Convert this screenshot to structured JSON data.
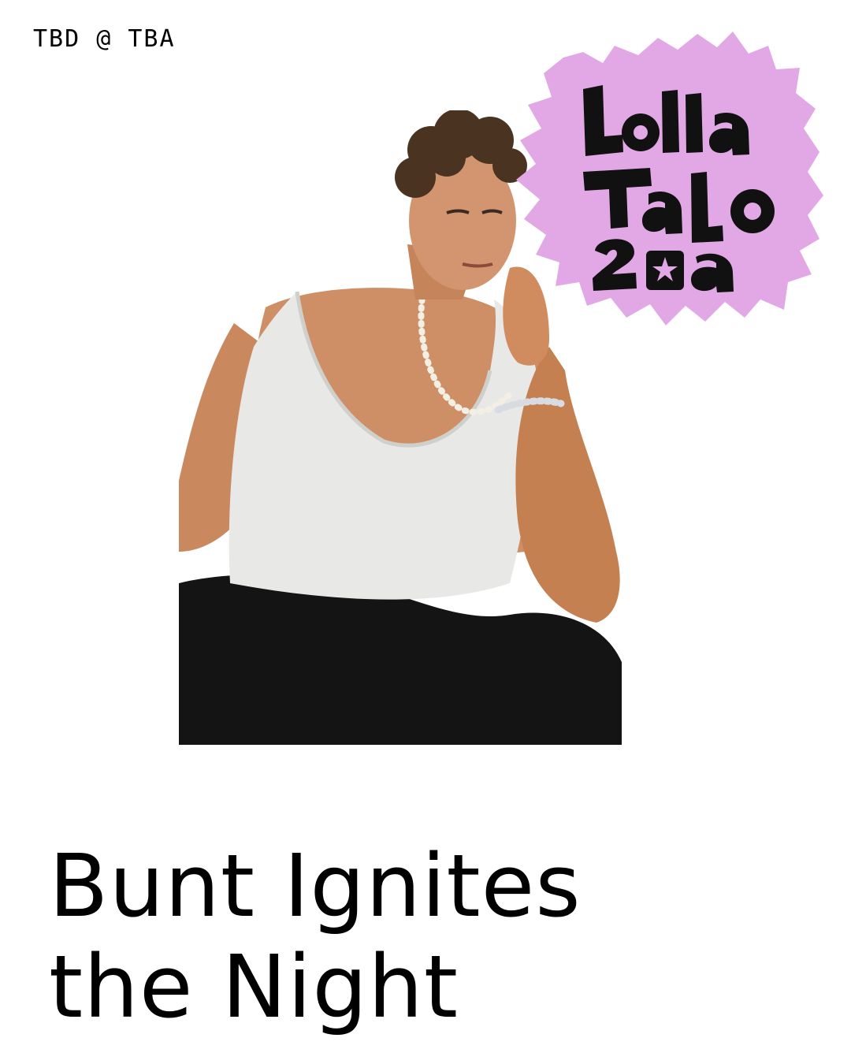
{
  "header": {
    "event_line": "TBD @ TBA"
  },
  "badge": {
    "logo_text": "LOLLAPALOOZA 2023",
    "bg_color": "#e2a8e6"
  },
  "photo": {
    "subject": "artist portrait"
  },
  "headline": {
    "line1": "Bunt Ignites",
    "line2": "the Night"
  },
  "colors": {
    "background": "#ffffff",
    "text": "#000000",
    "badge": "#e2a8e6"
  }
}
